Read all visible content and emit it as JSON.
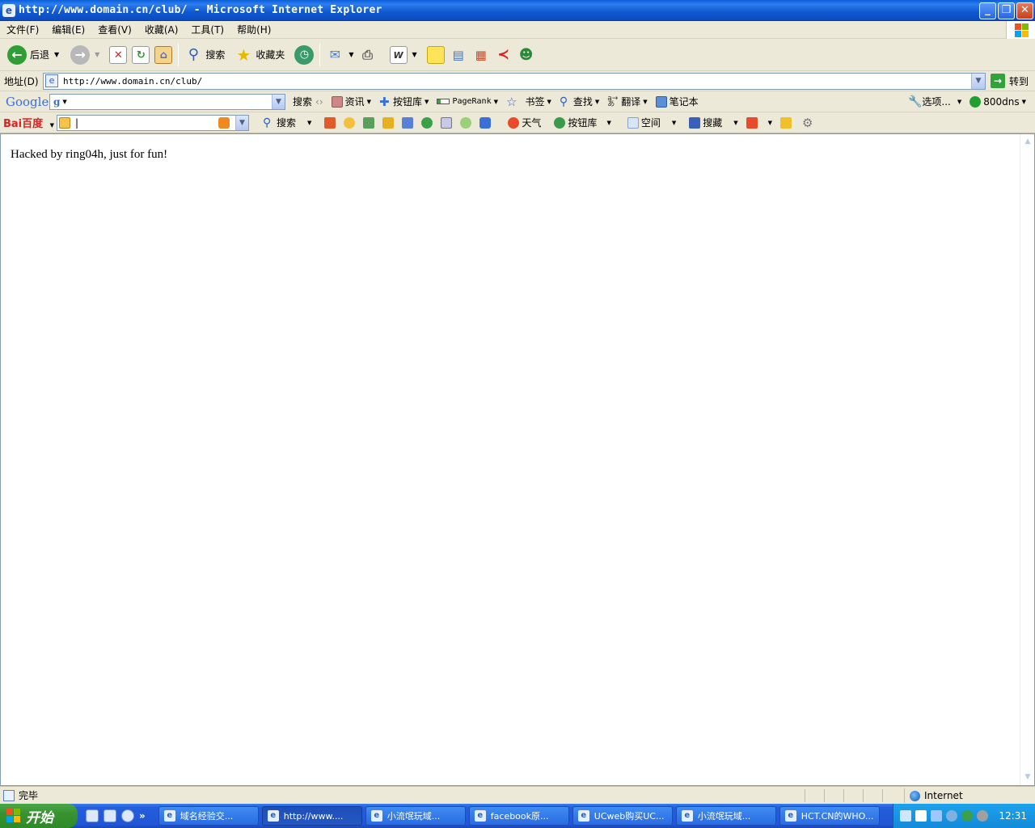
{
  "window": {
    "title": "http://www.domain.cn/club/ - Microsoft Internet Explorer",
    "minimize": "_",
    "restore": "❐",
    "close": "✕"
  },
  "menu": [
    "文件(F)",
    "编辑(E)",
    "查看(V)",
    "收藏(A)",
    "工具(T)",
    "帮助(H)"
  ],
  "toolbar": {
    "back_label": "后退",
    "search_label": "搜索",
    "favorites_label": "收藏夹"
  },
  "address": {
    "label": "地址(D)",
    "url": "http://www.domain.cn/club/",
    "go_label": "转到"
  },
  "google_bar": {
    "logo": "Google",
    "search_label": "搜索",
    "news_label": "资讯",
    "buttons_label": "按钮库",
    "pagerank_label": "PageRank",
    "bookmarks_label": "书签",
    "find_label": "查找",
    "translate_label": "翻译",
    "notebook_label": "笔记本",
    "options_label": "选项...",
    "dns_label": "800dns"
  },
  "baidu_bar": {
    "logo": "Bai百度",
    "input_value": "",
    "search_label": "搜索",
    "weather_label": "天气",
    "buttons_label": "按钮库",
    "space_label": "空间",
    "collect_label": "搜藏"
  },
  "page": {
    "body_text": "Hacked by ring04h, just for fun!"
  },
  "status": {
    "text": "完毕",
    "zone": "Internet"
  },
  "taskbar": {
    "start_label": "开始",
    "tasks": [
      "域名经验交...",
      "http://www....",
      "小流氓玩域...",
      "facebook原...",
      "UCweb购买UC...",
      "小流氓玩域...",
      "HCT.CN的WHO..."
    ],
    "clock": "12:31"
  }
}
